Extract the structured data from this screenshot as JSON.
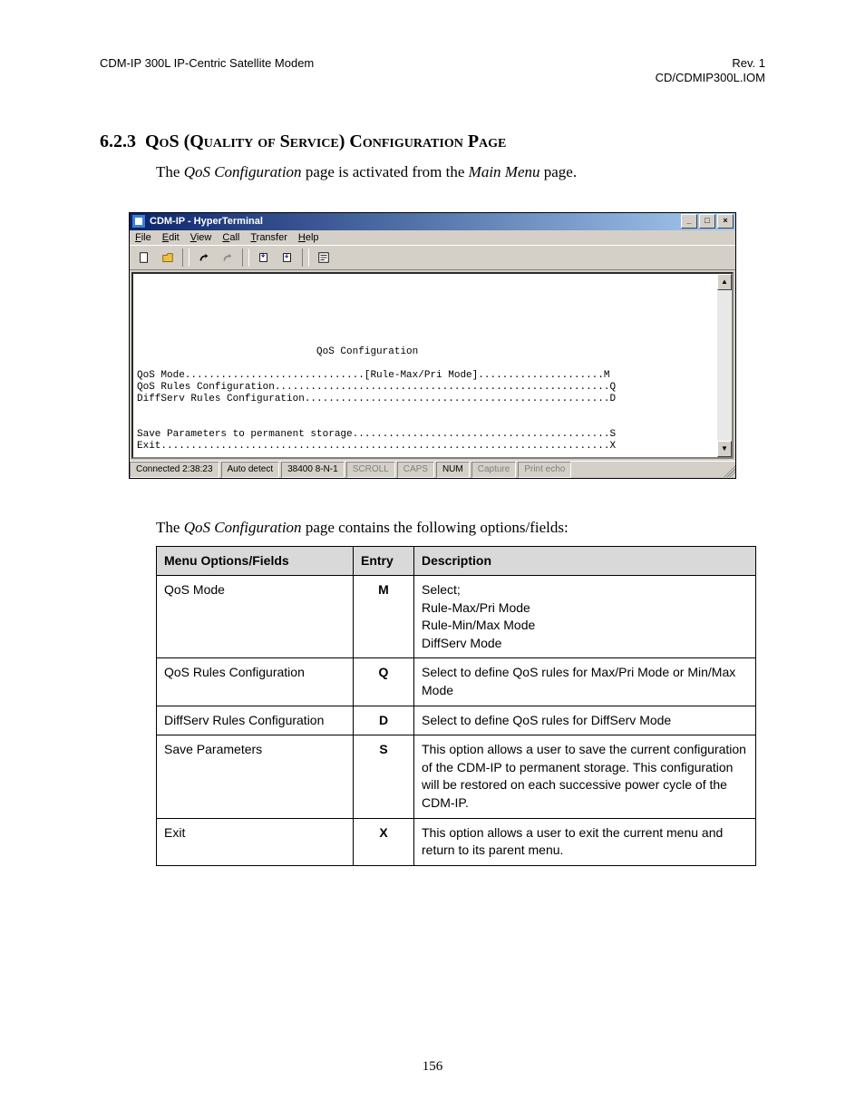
{
  "header": {
    "left": "CDM-IP 300L IP-Centric Satellite Modem",
    "right1": "Rev. 1",
    "right2": "CD/CDMIP300L.IOM"
  },
  "section": {
    "number": "6.2.3",
    "title_pre": "Q",
    "title_rest": "o",
    "title": "QoS (Quality of Service) Configuration Page"
  },
  "intro": {
    "t1": "The ",
    "i1": "QoS Configuration",
    "t2": " page is activated from the ",
    "i2": "Main Menu",
    "t3": " page."
  },
  "window": {
    "title": "CDM-IP - HyperTerminal",
    "btn_min": "_",
    "btn_max": "□",
    "btn_close": "×",
    "menu": {
      "file": "File",
      "edit": "Edit",
      "view": "View",
      "call": "Call",
      "transfer": "Transfer",
      "help": "Help"
    },
    "terminal": "\n\n\n\n\n\n                              QoS Configuration\n\nQoS Mode..............................[Rule-Max/Pri Mode].....................M\nQoS Rules Configuration........................................................Q\nDiffServ Rules Configuration...................................................D\n\n\nSave Parameters to permanent storage...........................................S\nExit...........................................................................X",
    "status": {
      "conn": "Connected 2:38:23",
      "detect": "Auto detect",
      "line": "38400 8-N-1",
      "scroll": "SCROLL",
      "caps": "CAPS",
      "num": "NUM",
      "capture": "Capture",
      "echo": "Print echo"
    }
  },
  "below": {
    "t1": "The ",
    "i1": "QoS Configuration",
    "t2": " page contains the following options/fields:"
  },
  "table": {
    "h1": "Menu Options/Fields",
    "h2": "Entry",
    "h3": "Description",
    "rows": [
      {
        "name": "QoS Mode",
        "entry": "M",
        "desc": "Select;\nRule-Max/Pri Mode\nRule-Min/Max Mode\nDiffServ Mode"
      },
      {
        "name": "QoS Rules Configuration",
        "entry": "Q",
        "desc": "Select to define QoS rules for Max/Pri Mode or Min/Max Mode"
      },
      {
        "name": "DiffServ Rules Configuration",
        "entry": "D",
        "desc": "Select to define QoS rules for DiffServ Mode"
      },
      {
        "name": "Save Parameters",
        "entry": "S",
        "desc": "This option allows a user to save the current configuration of the CDM-IP to permanent storage. This configuration will be restored on each successive power cycle of the CDM-IP."
      },
      {
        "name": "Exit",
        "entry": "X",
        "desc": "This option allows a user to exit the current menu and return to its parent menu."
      }
    ]
  },
  "pagenum": "156"
}
